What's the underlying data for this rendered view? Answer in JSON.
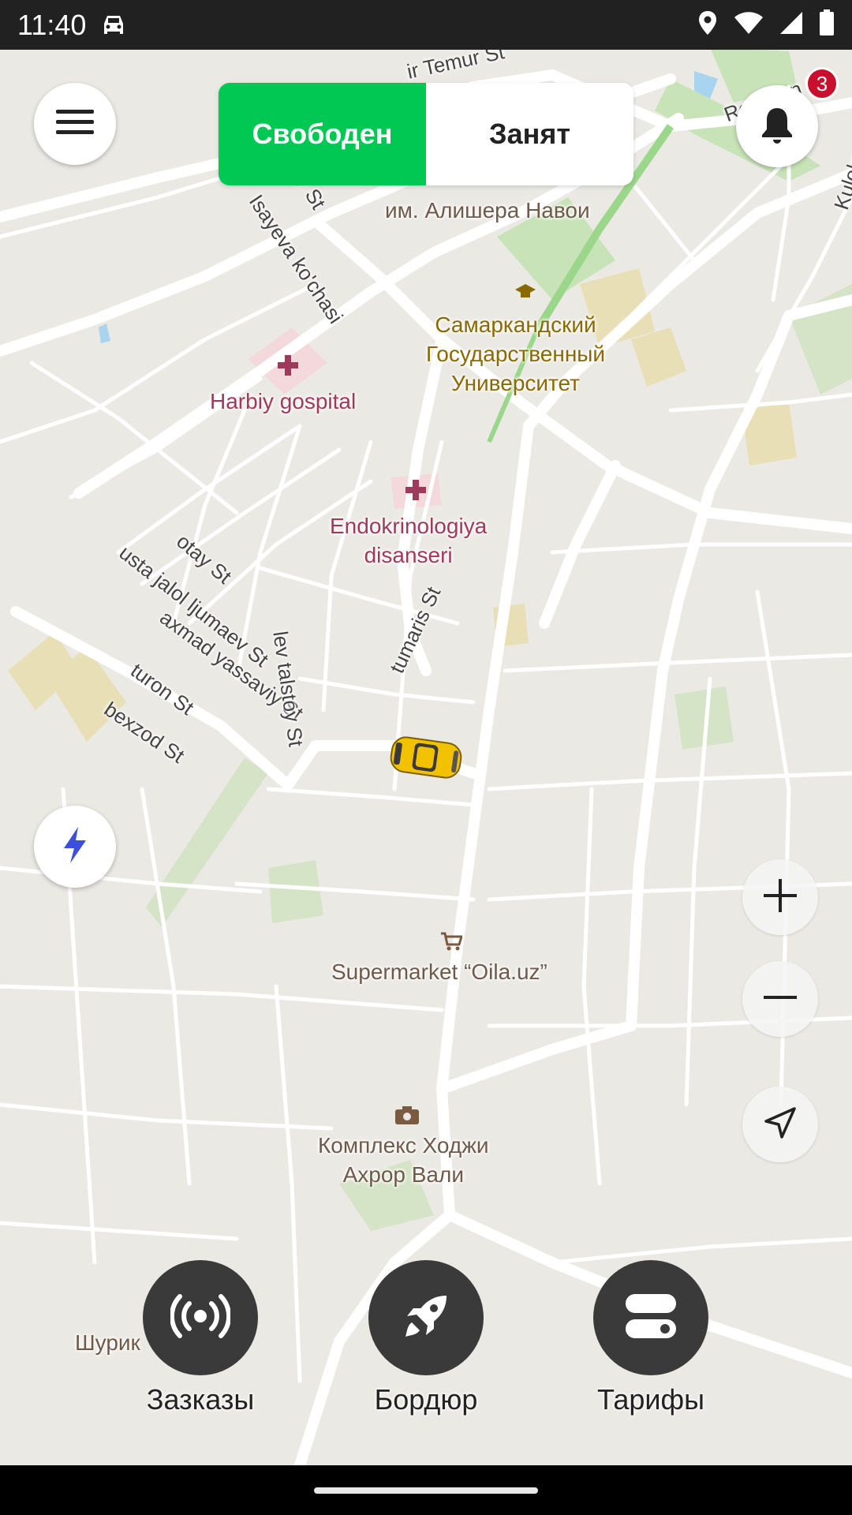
{
  "status_bar": {
    "time": "11:40",
    "icons": [
      "car-icon",
      "location-icon",
      "wifi-icon",
      "signal-icon",
      "battery-icon"
    ]
  },
  "top": {
    "menu_icon": "menu-icon",
    "status_toggle": {
      "free_label": "Свободен",
      "busy_label": "Занят",
      "active": "free"
    },
    "notifications_icon": "bell-icon",
    "notification_count": "3"
  },
  "map": {
    "streets": {
      "temur": "ir Temur St",
      "registan": "Registan St",
      "kulolon": "Kulolon St",
      "isayeva": "Isayeva ko'chasi",
      "otay": "otay St",
      "usta": "usta jalol ljumaev St",
      "axmad": "axmad yassaviy St",
      "turon": "turon St",
      "bexzod": "bexzod St",
      "lev": "lev talstoy St",
      "tumaris": "tumaris St",
      "top_st": "y St"
    },
    "pois": {
      "navoi": "им. Алишера Навои",
      "university": "Самаркандский\nГосударственный\nУниверситет",
      "hospital": "Harbiy gospital",
      "endo": "Endokrinologiya\ndisanseri",
      "supermarket": "Supermarket “Oila.uz”",
      "complex": "Комплекс Ходжи\nАхрор Вали",
      "shurik": "Шурик"
    }
  },
  "map_controls": [
    "lightning-icon",
    "zoom-in-icon",
    "zoom-out-icon",
    "navigate-icon"
  ],
  "actions": [
    {
      "label": "Зазказы",
      "icon": "broadcast-icon"
    },
    {
      "label": "Бордюр",
      "icon": "rocket-icon"
    },
    {
      "label": "Тарифы",
      "icon": "toggle-icon"
    }
  ],
  "colors": {
    "accent": "#00c853",
    "badge": "#c8102e",
    "action_bg": "#3a3a3a"
  }
}
